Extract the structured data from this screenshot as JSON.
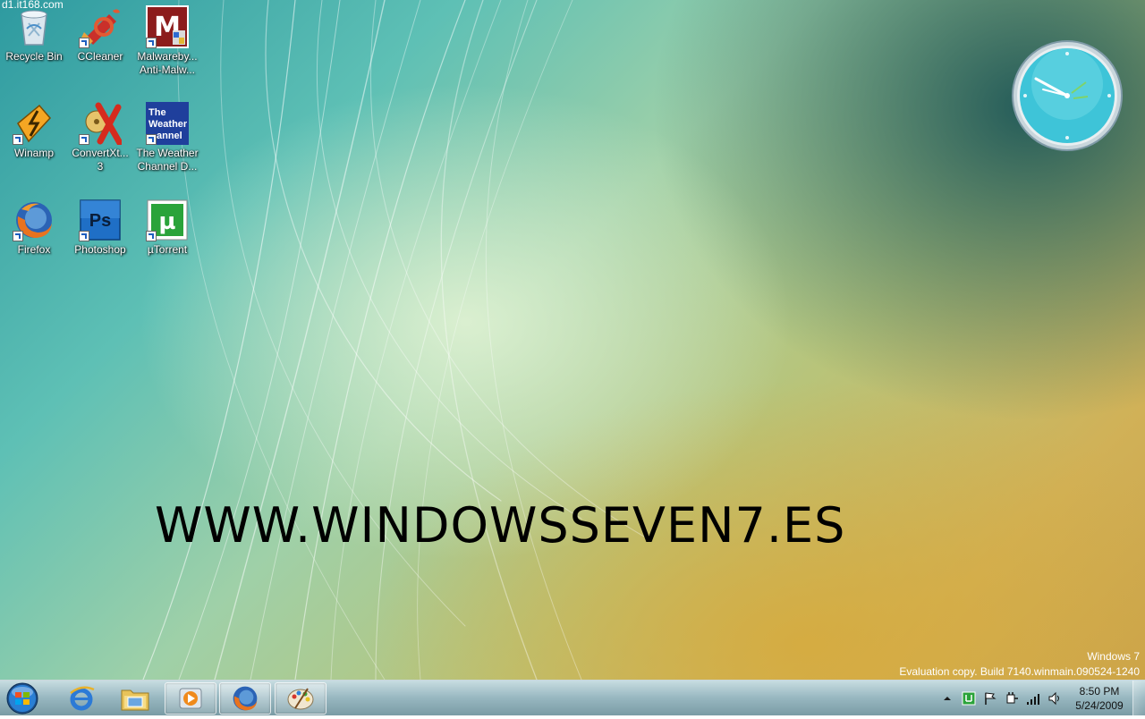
{
  "watermark_top": "d1.it168.com",
  "desktop_icons": [
    {
      "label": "Recycle Bin",
      "icon": "recycle-bin-icon"
    },
    {
      "label": "CCleaner",
      "icon": "ccleaner-icon"
    },
    {
      "label": "Malwareby...\nAnti-Malw...",
      "icon": "malwarebytes-icon"
    },
    {
      "label": "Winamp",
      "icon": "winamp-icon"
    },
    {
      "label": "ConvertXt...\n3",
      "icon": "convertxtodvd-icon"
    },
    {
      "label": "The Weather\nChannel D...",
      "icon": "weather-channel-icon"
    },
    {
      "label": "Firefox",
      "icon": "firefox-icon"
    },
    {
      "label": "Photoshop",
      "icon": "photoshop-icon"
    },
    {
      "label": "µTorrent",
      "icon": "utorrent-icon"
    }
  ],
  "weather_logo_text": [
    "The",
    "Weather",
    "annel"
  ],
  "photoshop_logo_text": "Ps",
  "utorrent_logo_text": "µ",
  "malwarebytes_logo_text": "M",
  "site_text": "WWW.WINDOWSSEVEN7.ES",
  "build_info": {
    "line1": "Windows 7",
    "line2": "Evaluation copy. Build 7140.winmain.090524-1240"
  },
  "taskbar": {
    "pinned": [
      "internet-explorer-icon",
      "windows-explorer-icon",
      "media-player-icon",
      "firefox-icon",
      "paint-icon"
    ],
    "active_items": [
      "media-player-icon",
      "firefox-icon",
      "paint-icon"
    ],
    "tray_icons": [
      "show-hidden-icons-arrow",
      "utorrent-tray-icon",
      "action-center-flag-icon",
      "power-plug-icon",
      "network-signal-icon",
      "volume-icon"
    ],
    "time": "8:50 PM",
    "date": "5/24/2009"
  },
  "colors": {
    "start_orb": "#2a7fd4",
    "text_white": "#ffffff",
    "site_text": "#000000"
  }
}
